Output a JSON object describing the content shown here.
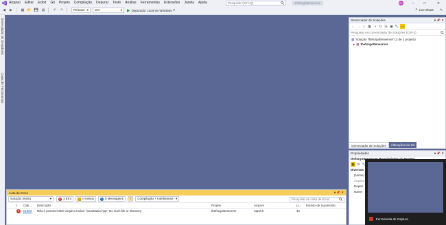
{
  "menu": [
    "Arquivo",
    "Editar",
    "Exibir",
    "Git",
    "Projeto",
    "Compilação",
    "Depurar",
    "Teste",
    "Análise",
    "Ferramentas",
    "Extensões",
    "Janela",
    "Ajuda"
  ],
  "search": {
    "placeholder": "Pesquisar (Ctrl+Q)"
  },
  "project_name": "theforgottenserver",
  "user_initials": "EL",
  "toolbar": {
    "config": "Release",
    "platform": "x64",
    "run_label": "Depurador Local do Windows",
    "live_share": "Live Share"
  },
  "side_tabs": [
    "Gerenciador de Servidores",
    "Caixa de Ferramentas"
  ],
  "solution_explorer": {
    "title": "Gerenciador de Soluções",
    "search_placeholder": "Pesquisar em Gerenciador de Soluções (Ctrl+ç)",
    "solution_label": "Solução 'theforgottenserver' (1 de 1 projeto)",
    "project_label": "theforgottenserver",
    "tabs": [
      "Gerenciador de Soluções",
      "Alterações do Git"
    ]
  },
  "properties": {
    "title": "Propriedades",
    "object": "theforgottenserver Propriedades do Projeto",
    "rows": [
      "Diversos",
      "(Nome)",
      "Arquivo",
      "Depen",
      "Name"
    ]
  },
  "capture": {
    "label": "Ferramenta de Captura"
  },
  "error_list": {
    "title": "Lista de Erros",
    "scope": "Solução Inteira",
    "errors_chip": "1 Erro",
    "warnings_chip": "0 Avisos",
    "messages_chip": "0 Mensagens",
    "build_filter": "Compilação + IntelliSense",
    "search_placeholder": "Pesquisar na Lista de Erros",
    "columns": [
      "Códi...",
      "Descrição",
      "Projeto",
      "Arquivo",
      "Li...",
      "Estado de Supressão"
    ],
    "rows": [
      {
        "code": "C1083",
        "description": "Não é possível abrir arquivo incluir: 'boost/asio.hpp': No such file or directory",
        "project": "theforgottenserver",
        "file": "otpch.h",
        "line": "42",
        "state": ""
      }
    ]
  },
  "colors": {
    "canvas": "#5b6795",
    "error_header": "#f5cd5b",
    "error_red": "#c0392b"
  }
}
